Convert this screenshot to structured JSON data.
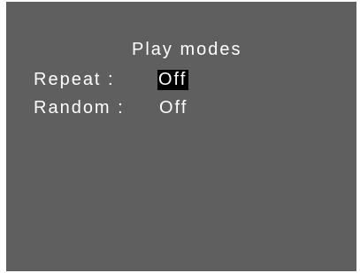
{
  "menu": {
    "title": "Play modes",
    "items": [
      {
        "label": "Repeat :",
        "value": "Off",
        "selected": true
      },
      {
        "label": "Random :",
        "value": "Off",
        "selected": false
      }
    ]
  },
  "colors": {
    "background": "#5f5f5f",
    "text": "#ffffff",
    "highlight": "#000000"
  }
}
